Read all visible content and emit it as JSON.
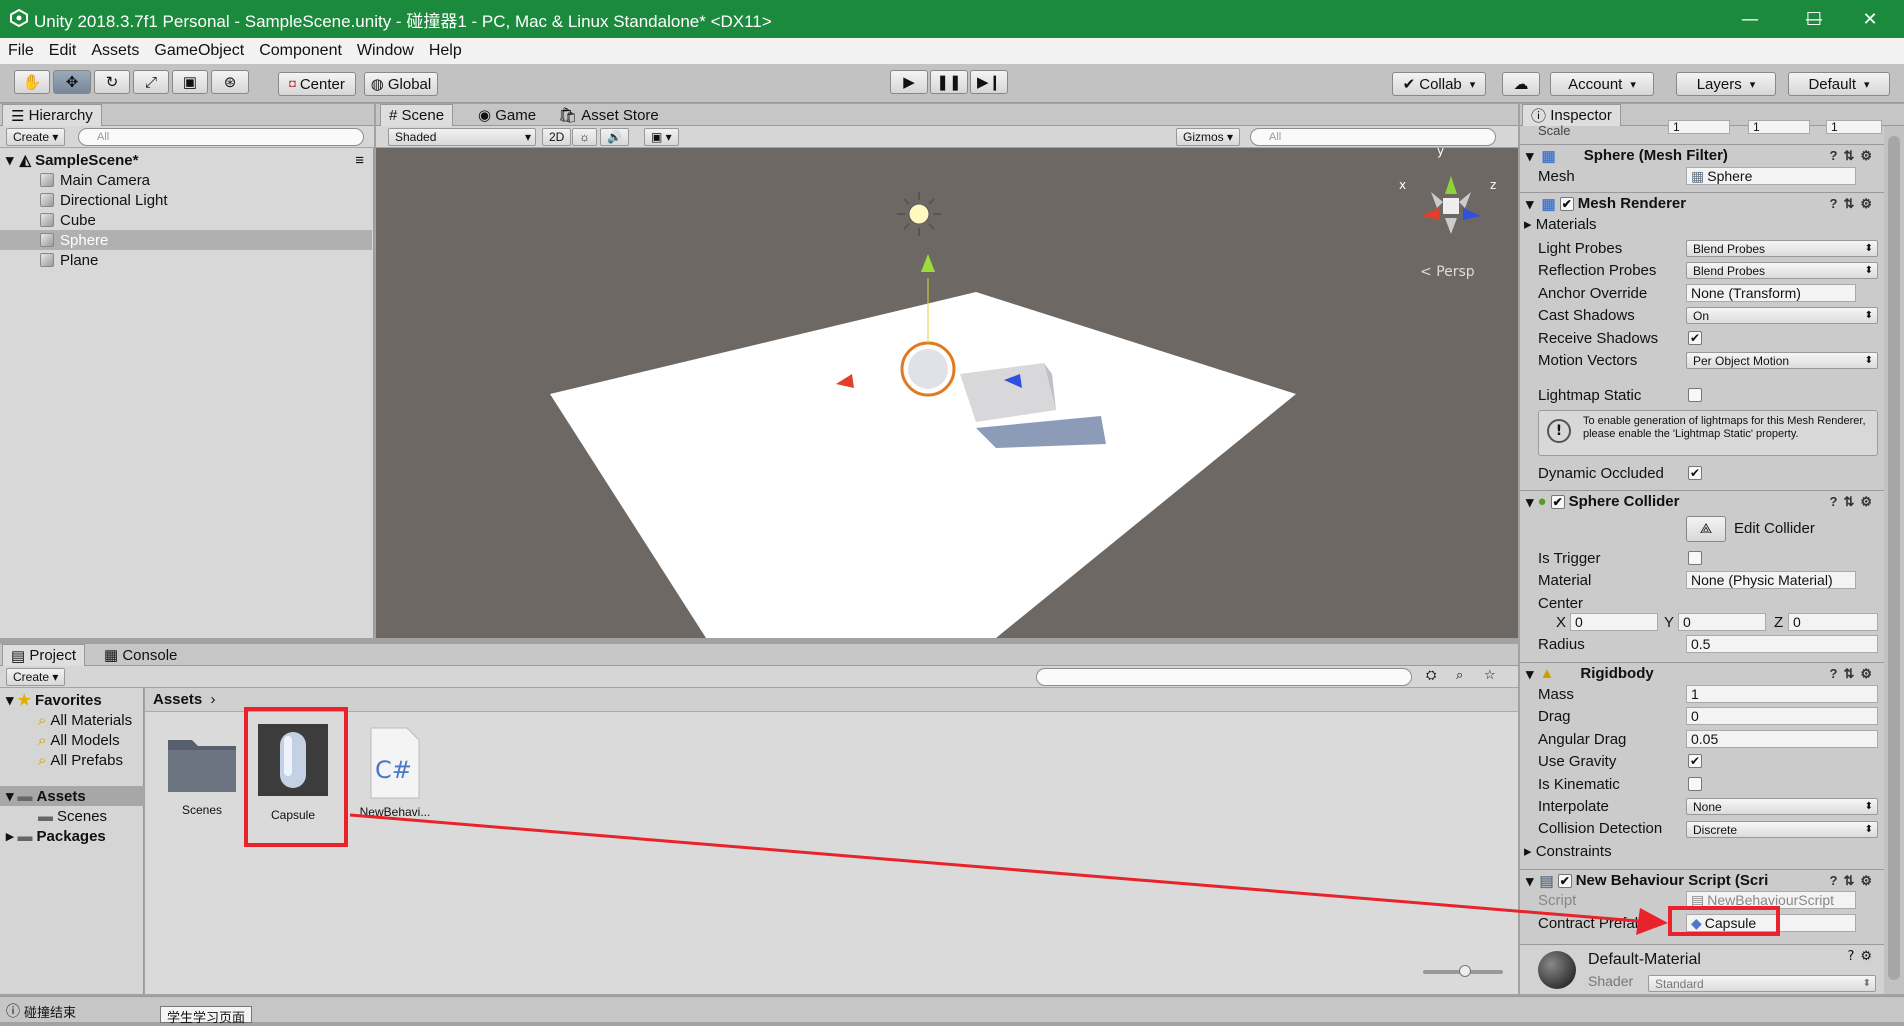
{
  "window": {
    "title": "Unity 2018.3.7f1 Personal - SampleScene.unity - 碰撞器1 - PC, Mac & Linux Standalone* <DX11>",
    "minimize": "—",
    "maximize": "☐",
    "close": "✕"
  },
  "menu": [
    "File",
    "Edit",
    "Assets",
    "GameObject",
    "Component",
    "Window",
    "Help"
  ],
  "toolbar": {
    "pivot_label": "Center",
    "space_label": "Global",
    "collab_label": "Collab",
    "account_label": "Account",
    "layers_label": "Layers",
    "layout_label": "Default"
  },
  "hierarchy": {
    "tab": "Hierarchy",
    "create": "Create",
    "search_placeholder": "All",
    "scene": "SampleScene*",
    "items": [
      "Main Camera",
      "Directional Light",
      "Cube",
      "Sphere",
      "Plane"
    ],
    "selected_index": 3
  },
  "scene_view": {
    "tabs": [
      "Scene",
      "Game",
      "Asset Store"
    ],
    "shading": "Shaded",
    "mode_2d": "2D",
    "gizmos": "Gizmos",
    "search_placeholder": "All",
    "persp": "Persp",
    "axis_x": "x",
    "axis_y": "y",
    "axis_z": "z"
  },
  "project": {
    "tabs": [
      "Project",
      "Console"
    ],
    "create": "Create",
    "favorites": "Favorites",
    "favorite_items": [
      "All Materials",
      "All Models",
      "All Prefabs"
    ],
    "assets_root": "Assets",
    "asset_folders": [
      "Scenes"
    ],
    "packages": "Packages",
    "breadcrumb": "Assets",
    "assets": [
      {
        "name": "Scenes",
        "icon": "folder-icon"
      },
      {
        "name": "Capsule",
        "icon": "capsule-prefab-icon"
      },
      {
        "name": "NewBehavi...",
        "icon": "csharp-script-icon"
      }
    ]
  },
  "inspector": {
    "tab": "Inspector",
    "scale_label": "Scale",
    "scale": {
      "x": "1",
      "y": "1",
      "z": "1"
    },
    "mesh_filter": {
      "title": "Sphere (Mesh Filter)",
      "mesh_label": "Mesh",
      "mesh_value": "Sphere"
    },
    "mesh_renderer": {
      "title": "Mesh Renderer",
      "materials": "Materials",
      "light_probes_label": "Light Probes",
      "light_probes": "Blend Probes",
      "reflection_probes_label": "Reflection Probes",
      "reflection_probes": "Blend Probes",
      "anchor_override_label": "Anchor Override",
      "anchor_override": "None (Transform)",
      "cast_shadows_label": "Cast Shadows",
      "cast_shadows": "On",
      "receive_shadows_label": "Receive Shadows",
      "motion_vectors_label": "Motion Vectors",
      "motion_vectors": "Per Object Motion",
      "lightmap_static_label": "Lightmap Static",
      "info": "To enable generation of lightmaps for this Mesh Renderer, please enable the 'Lightmap Static' property.",
      "dynamic_occluded_label": "Dynamic Occluded"
    },
    "sphere_collider": {
      "title": "Sphere Collider",
      "edit_collider": "Edit Collider",
      "is_trigger_label": "Is Trigger",
      "material_label": "Material",
      "material": "None (Physic Material)",
      "center_label": "Center",
      "center": {
        "x": "0",
        "y": "0",
        "z": "0"
      },
      "radius_label": "Radius",
      "radius": "0.5"
    },
    "rigidbody": {
      "title": "Rigidbody",
      "mass_label": "Mass",
      "mass": "1",
      "drag_label": "Drag",
      "drag": "0",
      "angular_drag_label": "Angular Drag",
      "angular_drag": "0.05",
      "use_gravity_label": "Use Gravity",
      "is_kinematic_label": "Is Kinematic",
      "interpolate_label": "Interpolate",
      "interpolate": "None",
      "collision_detection_label": "Collision Detection",
      "collision_detection": "Discrete",
      "constraints_label": "Constraints"
    },
    "script": {
      "title": "New Behaviour Script (Scri",
      "script_label": "Script",
      "script_value": "NewBehaviourScript",
      "contract_label": "Contract Prefab",
      "contract_value": "Capsule"
    },
    "material": {
      "title": "Default-Material",
      "shader_label": "Shader",
      "shader": "Standard"
    }
  },
  "status": {
    "message": "碰撞结束",
    "tooltip": "学生学习页面"
  },
  "colors": {
    "title_bar": "#1b8a3c",
    "annotation_red": "#e8232b",
    "selection": "#8eaed8"
  }
}
